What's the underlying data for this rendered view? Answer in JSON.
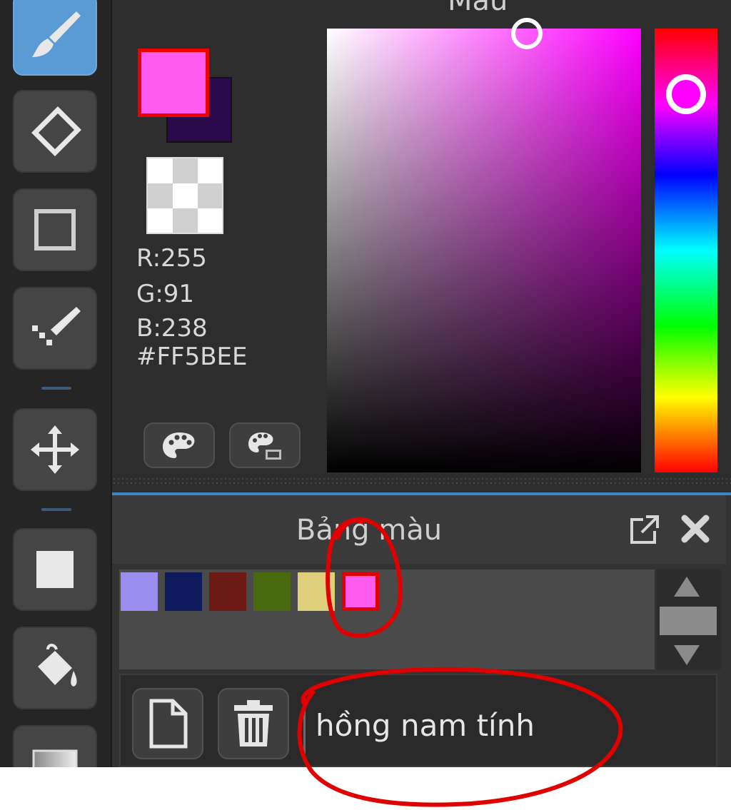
{
  "color_panel": {
    "title": "Màu",
    "fg_color": "#FF5BEE",
    "bg_color": "#2A0A4A",
    "rgb": {
      "r": "R:255",
      "g": "G:91",
      "b": "B:238",
      "hex": "#FF5BEE"
    },
    "buttons": [
      "palette-icon",
      "palette-edit-icon"
    ],
    "hue_color": "#FF00FF"
  },
  "palette_panel": {
    "title": "Bảng màu",
    "swatches": [
      "#9b8cf0",
      "#0d1a5c",
      "#6b1a14",
      "#4a6a10",
      "#ded07a",
      "#ff5bee"
    ],
    "selected_swatch_index": 5,
    "name_value": "hồng nam tính"
  },
  "annotation_color": "#e00000"
}
